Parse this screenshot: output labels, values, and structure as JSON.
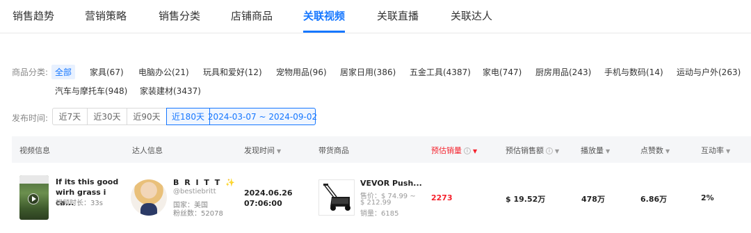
{
  "tabs": [
    {
      "label": "销售趋势"
    },
    {
      "label": "营销策略"
    },
    {
      "label": "销售分类"
    },
    {
      "label": "店铺商品"
    },
    {
      "label": "关联视频",
      "active": true
    },
    {
      "label": "关联直播"
    },
    {
      "label": "关联达人"
    }
  ],
  "category_filter": {
    "label": "商品分类:",
    "items": [
      {
        "label": "全部",
        "active": true
      },
      {
        "label": "家具(67)"
      },
      {
        "label": "电脑办公(21)"
      },
      {
        "label": "玩具和爱好(12)"
      },
      {
        "label": "宠物用品(96)"
      },
      {
        "label": "居家日用(386)"
      },
      {
        "label": "五金工具(4387)"
      },
      {
        "label": "家电(747)"
      },
      {
        "label": "厨房用品(243)"
      },
      {
        "label": "手机与数码(14)"
      },
      {
        "label": "运动与户外(263)"
      },
      {
        "label": "汽车与摩托车(948)"
      },
      {
        "label": "家装建材(3437)"
      }
    ]
  },
  "publish_time": {
    "label": "发布时间:",
    "options": [
      {
        "label": "近7天"
      },
      {
        "label": "近30天"
      },
      {
        "label": "近90天"
      },
      {
        "label": "近180天",
        "active": true
      }
    ],
    "date_range": "2024-03-07 ~ 2024-09-02"
  },
  "table": {
    "headers": {
      "video_info": "视频信息",
      "influencer_info": "达人信息",
      "publish_time": "发现时间",
      "product": "带货商品",
      "est_sales": "预估销量",
      "est_revenue": "预估销售额",
      "plays": "播放量",
      "likes": "点赞数",
      "engagement": "互动率"
    },
    "rows": [
      {
        "video_title": "If its this good wirh grass i ca...",
        "video_duration": "视频时长：33s",
        "influencer_name": "B R I T T ✨",
        "influencer_handle": "@bestiebritt",
        "influencer_country": "国家：美国",
        "influencer_fans": "粉丝数：52078",
        "time_date": "2024.06.26",
        "time_clock": "07:06:00",
        "product_title": "VEVOR Push...",
        "product_price_line1": "售价：$ 74.99 ~",
        "product_price_line2": "$ 212.99",
        "product_sales": "销量：6185",
        "est_sales": "2273",
        "est_revenue": "$ 19.52万",
        "plays": "478万",
        "likes": "6.86万",
        "engagement": "2%"
      }
    ]
  },
  "colors": {
    "accent": "#1677ff",
    "highlight_red": "#f5222d"
  }
}
